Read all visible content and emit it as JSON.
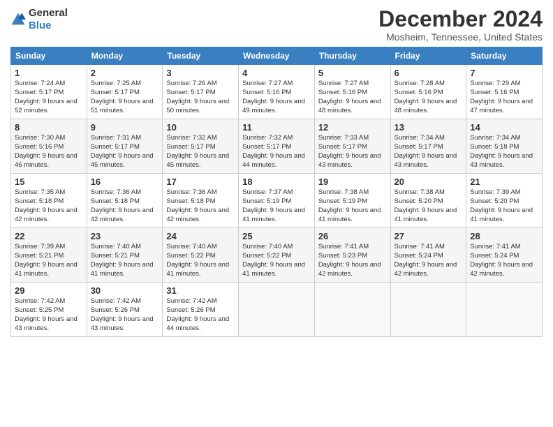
{
  "header": {
    "logo_general": "General",
    "logo_blue": "Blue",
    "title": "December 2024",
    "location": "Mosheim, Tennessee, United States"
  },
  "days_of_week": [
    "Sunday",
    "Monday",
    "Tuesday",
    "Wednesday",
    "Thursday",
    "Friday",
    "Saturday"
  ],
  "weeks": [
    [
      {
        "day": "1",
        "sunrise": "7:24 AM",
        "sunset": "5:17 PM",
        "daylight": "9 hours and 52 minutes."
      },
      {
        "day": "2",
        "sunrise": "7:25 AM",
        "sunset": "5:17 PM",
        "daylight": "9 hours and 51 minutes."
      },
      {
        "day": "3",
        "sunrise": "7:26 AM",
        "sunset": "5:17 PM",
        "daylight": "9 hours and 50 minutes."
      },
      {
        "day": "4",
        "sunrise": "7:27 AM",
        "sunset": "5:16 PM",
        "daylight": "9 hours and 49 minutes."
      },
      {
        "day": "5",
        "sunrise": "7:27 AM",
        "sunset": "5:16 PM",
        "daylight": "9 hours and 48 minutes."
      },
      {
        "day": "6",
        "sunrise": "7:28 AM",
        "sunset": "5:16 PM",
        "daylight": "9 hours and 48 minutes."
      },
      {
        "day": "7",
        "sunrise": "7:29 AM",
        "sunset": "5:16 PM",
        "daylight": "9 hours and 47 minutes."
      }
    ],
    [
      {
        "day": "8",
        "sunrise": "7:30 AM",
        "sunset": "5:16 PM",
        "daylight": "9 hours and 46 minutes."
      },
      {
        "day": "9",
        "sunrise": "7:31 AM",
        "sunset": "5:17 PM",
        "daylight": "9 hours and 45 minutes."
      },
      {
        "day": "10",
        "sunrise": "7:32 AM",
        "sunset": "5:17 PM",
        "daylight": "9 hours and 45 minutes."
      },
      {
        "day": "11",
        "sunrise": "7:32 AM",
        "sunset": "5:17 PM",
        "daylight": "9 hours and 44 minutes."
      },
      {
        "day": "12",
        "sunrise": "7:33 AM",
        "sunset": "5:17 PM",
        "daylight": "9 hours and 43 minutes."
      },
      {
        "day": "13",
        "sunrise": "7:34 AM",
        "sunset": "5:17 PM",
        "daylight": "9 hours and 43 minutes."
      },
      {
        "day": "14",
        "sunrise": "7:34 AM",
        "sunset": "5:18 PM",
        "daylight": "9 hours and 43 minutes."
      }
    ],
    [
      {
        "day": "15",
        "sunrise": "7:35 AM",
        "sunset": "5:18 PM",
        "daylight": "9 hours and 42 minutes."
      },
      {
        "day": "16",
        "sunrise": "7:36 AM",
        "sunset": "5:18 PM",
        "daylight": "9 hours and 42 minutes."
      },
      {
        "day": "17",
        "sunrise": "7:36 AM",
        "sunset": "5:18 PM",
        "daylight": "9 hours and 42 minutes."
      },
      {
        "day": "18",
        "sunrise": "7:37 AM",
        "sunset": "5:19 PM",
        "daylight": "9 hours and 41 minutes."
      },
      {
        "day": "19",
        "sunrise": "7:38 AM",
        "sunset": "5:19 PM",
        "daylight": "9 hours and 41 minutes."
      },
      {
        "day": "20",
        "sunrise": "7:38 AM",
        "sunset": "5:20 PM",
        "daylight": "9 hours and 41 minutes."
      },
      {
        "day": "21",
        "sunrise": "7:39 AM",
        "sunset": "5:20 PM",
        "daylight": "9 hours and 41 minutes."
      }
    ],
    [
      {
        "day": "22",
        "sunrise": "7:39 AM",
        "sunset": "5:21 PM",
        "daylight": "9 hours and 41 minutes."
      },
      {
        "day": "23",
        "sunrise": "7:40 AM",
        "sunset": "5:21 PM",
        "daylight": "9 hours and 41 minutes."
      },
      {
        "day": "24",
        "sunrise": "7:40 AM",
        "sunset": "5:22 PM",
        "daylight": "9 hours and 41 minutes."
      },
      {
        "day": "25",
        "sunrise": "7:40 AM",
        "sunset": "5:22 PM",
        "daylight": "9 hours and 41 minutes."
      },
      {
        "day": "26",
        "sunrise": "7:41 AM",
        "sunset": "5:23 PM",
        "daylight": "9 hours and 42 minutes."
      },
      {
        "day": "27",
        "sunrise": "7:41 AM",
        "sunset": "5:24 PM",
        "daylight": "9 hours and 42 minutes."
      },
      {
        "day": "28",
        "sunrise": "7:41 AM",
        "sunset": "5:24 PM",
        "daylight": "9 hours and 42 minutes."
      }
    ],
    [
      {
        "day": "29",
        "sunrise": "7:42 AM",
        "sunset": "5:25 PM",
        "daylight": "9 hours and 43 minutes."
      },
      {
        "day": "30",
        "sunrise": "7:42 AM",
        "sunset": "5:26 PM",
        "daylight": "9 hours and 43 minutes."
      },
      {
        "day": "31",
        "sunrise": "7:42 AM",
        "sunset": "5:26 PM",
        "daylight": "9 hours and 44 minutes."
      },
      null,
      null,
      null,
      null
    ]
  ]
}
